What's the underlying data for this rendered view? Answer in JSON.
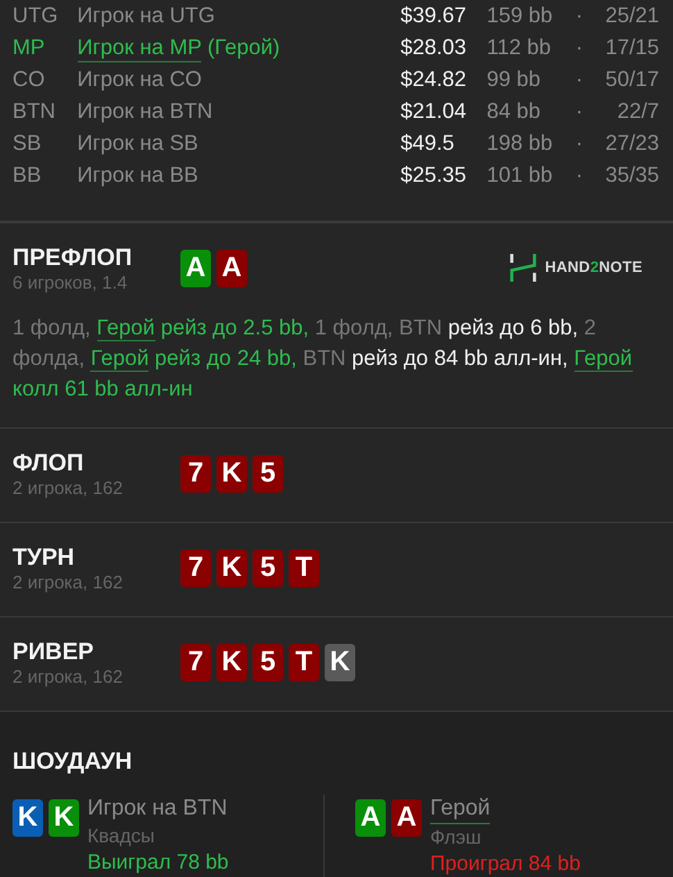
{
  "players": [
    {
      "position": "UTG",
      "name": "Игрок на UTG",
      "hero": false,
      "stack": "$39.67",
      "bb": "159 bb",
      "separator": "·",
      "ratio": "25/21"
    },
    {
      "position": "MP",
      "name": "Игрок на MP",
      "hero": true,
      "tag": "(Герой)",
      "stack": "$28.03",
      "bb": "112 bb",
      "separator": "·",
      "ratio": "17/15"
    },
    {
      "position": "CO",
      "name": "Игрок на CO",
      "hero": false,
      "stack": "$24.82",
      "bb": "99 bb",
      "separator": "·",
      "ratio": "50/17"
    },
    {
      "position": "BTN",
      "name": "Игрок на BTN",
      "hero": false,
      "stack": "$21.04",
      "bb": "84 bb",
      "separator": "·",
      "ratio": "22/7"
    },
    {
      "position": "SB",
      "name": "Игрок на SB",
      "hero": false,
      "stack": "$49.5",
      "bb": "198 bb",
      "separator": "·",
      "ratio": "27/23"
    },
    {
      "position": "BB",
      "name": "Игрок на BB",
      "hero": false,
      "stack": "$25.35",
      "bb": "101 bb",
      "separator": "·",
      "ratio": "35/35"
    }
  ],
  "streets": [
    {
      "title": "ПРЕФЛОП",
      "subtitle": "6 игроков, 1.4",
      "cards": [
        {
          "rank": "A",
          "color": "#0a8f0a"
        },
        {
          "rank": "A",
          "color": "#8b0000"
        }
      ],
      "logo": {
        "parts": [
          {
            "text": "HAND",
            "accent": false
          },
          {
            "text": "2",
            "accent": true
          },
          {
            "text": "NOTE",
            "accent": false
          }
        ]
      },
      "actions": [
        {
          "kind": "muted",
          "text": "1 фолд, "
        },
        {
          "kind": "hero-link",
          "text": "Герой"
        },
        {
          "kind": "hero",
          "text": " рейз до 2.5 bb, "
        },
        {
          "kind": "muted",
          "text": "1 фолд, BTN"
        },
        {
          "kind": "action",
          "text": " рейз до 6 bb, "
        },
        {
          "kind": "muted",
          "text": "2 фолда, "
        },
        {
          "kind": "hero-link",
          "text": "Герой"
        },
        {
          "kind": "hero",
          "text": " рейз до 24 bb, "
        },
        {
          "kind": "muted",
          "text": "BTN"
        },
        {
          "kind": "action",
          "text": " рейз до 84 bb алл-ин, "
        },
        {
          "kind": "hero-link",
          "text": "Герой"
        },
        {
          "kind": "hero",
          "text": " колл 61 bb алл-ин"
        }
      ]
    },
    {
      "title": "ФЛОП",
      "subtitle": "2 игрока, 162",
      "cards": [
        {
          "rank": "7",
          "color": "#8b0000"
        },
        {
          "rank": "K",
          "color": "#8b0000"
        },
        {
          "rank": "5",
          "color": "#8b0000"
        }
      ]
    },
    {
      "title": "ТУРН",
      "subtitle": "2 игрока, 162",
      "cards": [
        {
          "rank": "7",
          "color": "#8b0000"
        },
        {
          "rank": "K",
          "color": "#8b0000"
        },
        {
          "rank": "5",
          "color": "#8b0000"
        },
        {
          "rank": "T",
          "color": "#8b0000"
        }
      ]
    },
    {
      "title": "РИВЕР",
      "subtitle": "2 игрока, 162",
      "cards": [
        {
          "rank": "7",
          "color": "#8b0000"
        },
        {
          "rank": "K",
          "color": "#8b0000"
        },
        {
          "rank": "5",
          "color": "#8b0000"
        },
        {
          "rank": "T",
          "color": "#8b0000"
        },
        {
          "rank": "K",
          "color": "#5a5a5a"
        }
      ]
    }
  ],
  "showdown": {
    "title": "ШОУДАУН",
    "hands": [
      {
        "cards": [
          {
            "rank": "K",
            "color": "#0a5fb4"
          },
          {
            "rank": "K",
            "color": "#0a8f0a"
          }
        ],
        "player": "Игрок на BTN",
        "hero": false,
        "hand": "Квадсы",
        "result": "Выиграл 78 bb",
        "kind": "won"
      },
      {
        "cards": [
          {
            "rank": "A",
            "color": "#0a8f0a"
          },
          {
            "rank": "A",
            "color": "#8b0000"
          }
        ],
        "player": "Герой",
        "hero": true,
        "hand": "Флэш",
        "result": "Проиграл 84 bb",
        "kind": "lost"
      }
    ]
  }
}
